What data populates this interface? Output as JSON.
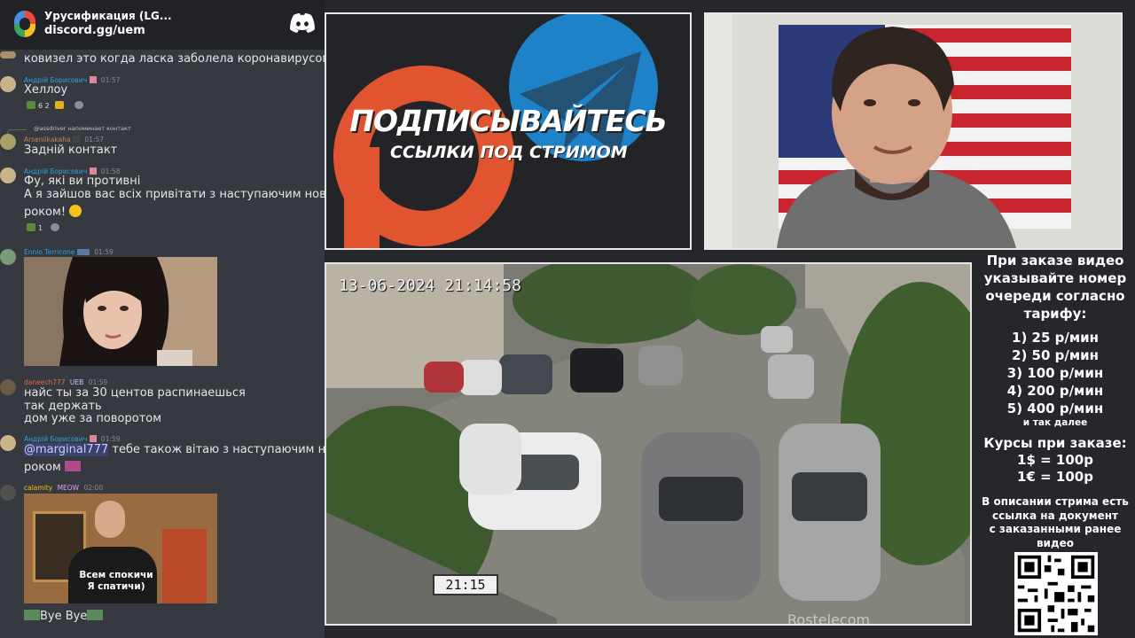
{
  "discord": {
    "server_name": "Урусификация (LG...",
    "invite": "discord.gg/uem",
    "messages": [
      {
        "text": "ковизел это когда ласка заболела коронавирусом?"
      },
      {
        "author": "Андрій Борисович",
        "time": "01:57",
        "text": "Хеллоу",
        "reactions": "6   2"
      },
      {
        "reply_to": "@assdriver напоминает контакт",
        "author": "Arseniikakaha",
        "time": "01:57",
        "text": "Задній контакт"
      },
      {
        "author": "Андрій Борисович",
        "time": "01:58",
        "lines": [
          "Фу, які ви противні",
          "А я зайшов вас всіх привітати з наступаючим новим",
          "роком!"
        ],
        "reactions": "1"
      },
      {
        "author": "Ennio Terricone",
        "time": "01:59"
      },
      {
        "author": "daneech777",
        "badge": "UEB",
        "time": "01:59",
        "lines": [
          "найс ты за 30 центов распинаешься",
          "так держать",
          "дом уже за поворотом"
        ]
      },
      {
        "author": "Андрій Борисович",
        "time": "01:59",
        "mention": "@marginal777",
        "lines": [
          "тебе також вітаю з наступаючим новим",
          "роком"
        ]
      },
      {
        "author": "calamity",
        "badge": "MEOW",
        "time": "02:00",
        "image_caption": [
          "Всем спокичи",
          "Я спатичи)"
        ],
        "text": "Bye Bye"
      }
    ]
  },
  "promo": {
    "title": "ПОДПИСЫВАЙТЕСЬ",
    "subtitle": "ССЫЛКИ ПОД СТРИМОМ",
    "colors": {
      "patreon": "#e0542f",
      "telegram": "#1e82c8"
    }
  },
  "cctv": {
    "timestamp": "13-06-2024 21:14:58",
    "clock": "21:15",
    "watermark": "Rostelecom"
  },
  "info": {
    "heading": [
      "При заказе видео",
      "указывайте номер",
      "очереди согласно",
      "тарифу:"
    ],
    "tiers": [
      "1) 25 р/мин",
      "2) 50 р/мин",
      "3) 100 р/мин",
      "4) 200 р/мин",
      "5) 400 р/мин"
    ],
    "and_so_on": "и так далее",
    "rates_heading": "Курсы при заказе:",
    "rates": [
      "1$ = 100р",
      "1€ = 100р"
    ],
    "description": [
      "В описании стрима есть",
      "ссылка на документ",
      "с заказанными ранее",
      "видео"
    ]
  }
}
